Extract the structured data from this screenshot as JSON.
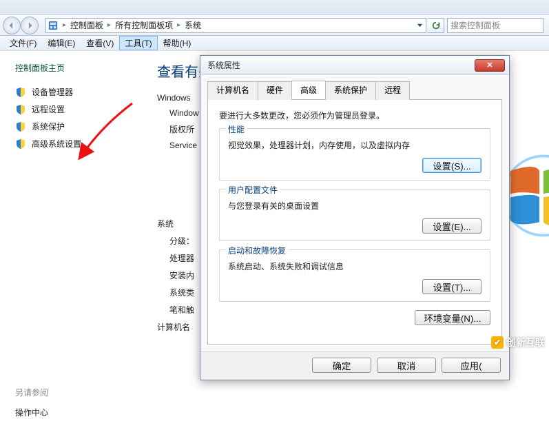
{
  "breadcrumb": {
    "seg1": "控制面板",
    "seg2": "所有控制面板项",
    "seg3": "系统"
  },
  "search": {
    "placeholder": "搜索控制面板"
  },
  "menu": {
    "file": "文件(F)",
    "edit": "编辑(E)",
    "view": "查看(V)",
    "tools": "工具(T)",
    "help": "帮助(H)"
  },
  "sidebar": {
    "home": "控制面板主页",
    "items": [
      {
        "label": "设备管理器"
      },
      {
        "label": "远程设置"
      },
      {
        "label": "系统保护"
      },
      {
        "label": "高级系统设置"
      }
    ],
    "see_also_header": "另请参阅",
    "see_also_item": "操作中心"
  },
  "content": {
    "heading_partial": "查看有关",
    "windows_line": "Windows",
    "rows": [
      "Window",
      "版权所",
      "Service"
    ],
    "section2": "系统",
    "rating_label": "分级：",
    "rows2": [
      "处理器",
      "安装内",
      "系统类",
      "笔和触"
    ],
    "section3": "计算机名"
  },
  "dialog": {
    "title": "系统属性",
    "close_glyph": "✕",
    "tabs": [
      "计算机名",
      "硬件",
      "高级",
      "系统保护",
      "远程"
    ],
    "active_tab_index": 2,
    "admin_note": "要进行大多数更改，您必须作为管理员登录。",
    "groups": {
      "perf": {
        "title": "性能",
        "desc": "视觉效果，处理器计划，内存使用，以及虚拟内存",
        "button": "设置(S)..."
      },
      "profile": {
        "title": "用户配置文件",
        "desc": "与您登录有关的桌面设置",
        "button": "设置(E)..."
      },
      "startup": {
        "title": "启动和故障恢复",
        "desc": "系统启动、系统失败和调试信息",
        "button": "设置(T)..."
      }
    },
    "env_button": "环境变量(N)...",
    "footer": {
      "ok": "确定",
      "cancel": "取消",
      "apply": "应用("
    }
  },
  "watermark": "创新互联"
}
